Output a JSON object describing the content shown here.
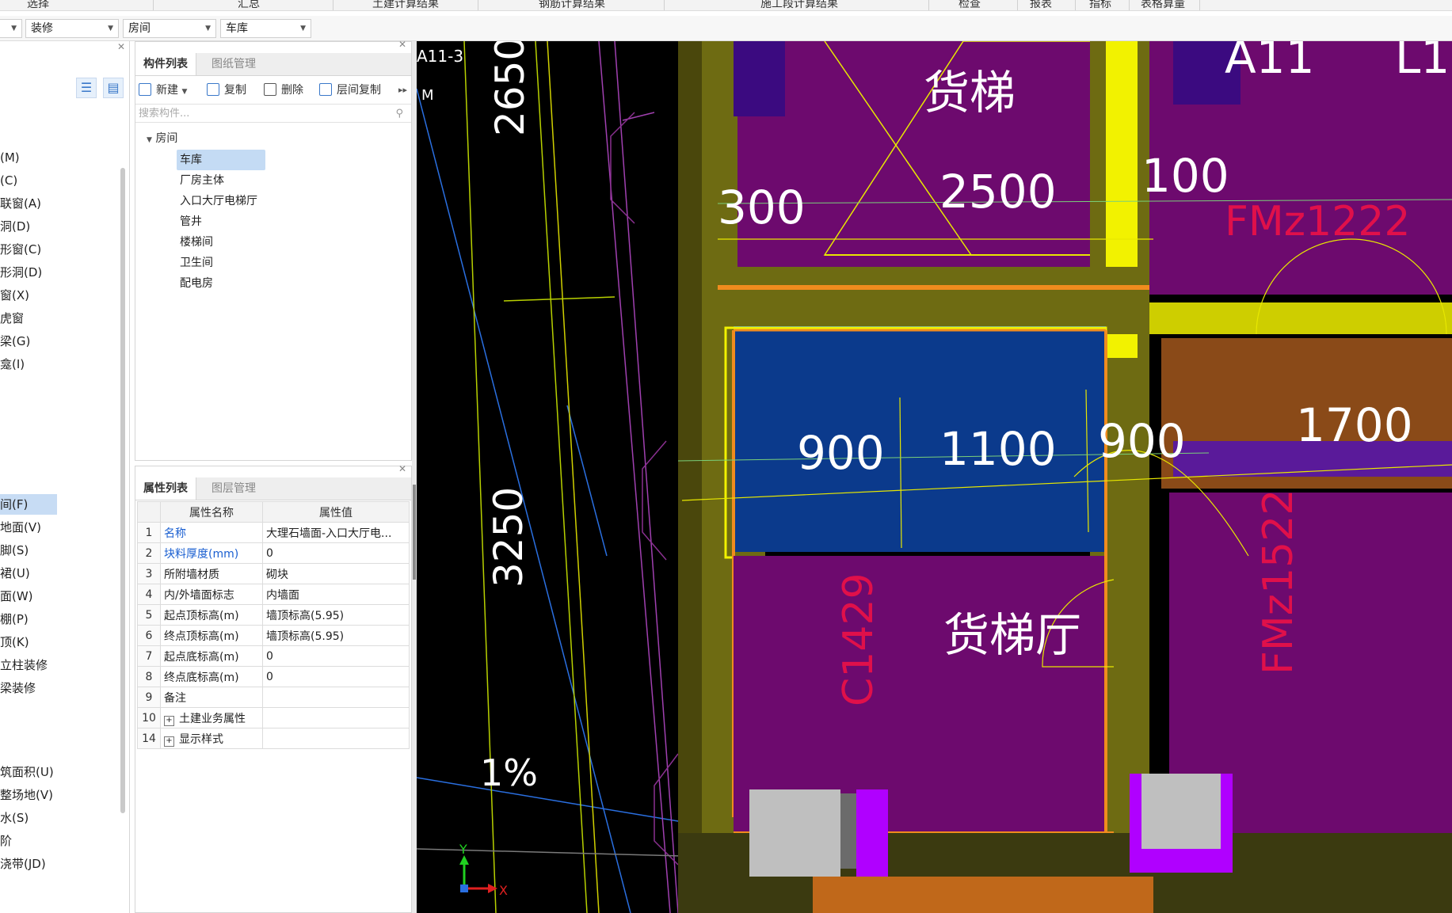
{
  "menu_tabs": [
    "选择",
    "汇总",
    "土建计算结果",
    "钢筋计算结果",
    "施工段计算结果",
    "检查",
    "报表",
    "指标",
    "表格算量"
  ],
  "selectors": [
    "",
    "装修",
    "房间",
    "车库"
  ],
  "left_panel": {
    "items_top": [
      "(M)",
      "(C)",
      "联窗(A)",
      "洞(D)",
      "形窗(C)",
      "形洞(D)",
      "窗(X)",
      "虎窗",
      "梁(G)",
      "龛(I)"
    ],
    "items_bottom": [
      "间(F)",
      "地面(V)",
      "脚(S)",
      "裙(U)",
      "面(W)",
      "棚(P)",
      "顶(K)",
      "立柱装修",
      "梁装修"
    ],
    "items_bottom2": [
      "筑面积(U)",
      "整场地(V)",
      "水(S)",
      "阶",
      "浇带(JD)"
    ]
  },
  "component_panel": {
    "tabs": [
      "构件列表",
      "图纸管理"
    ],
    "toolbar": {
      "new": "新建",
      "copy": "复制",
      "delete": "删除",
      "floor_copy": "层间复制"
    },
    "search_placeholder": "搜索构件...",
    "tree_root": "房间",
    "tree_items": [
      "车库",
      "厂房主体",
      "入口大厅电梯厅",
      "管井",
      "楼梯间",
      "卫生间",
      "配电房"
    ]
  },
  "property_panel": {
    "tabs": [
      "属性列表",
      "图层管理"
    ],
    "header_name": "属性名称",
    "header_value": "属性值",
    "rows": [
      {
        "no": "1",
        "name": "名称",
        "value": "大理石墙面-入口大厅电...",
        "blue": true
      },
      {
        "no": "2",
        "name": "块料厚度(mm)",
        "value": "0",
        "blue": true
      },
      {
        "no": "3",
        "name": "所附墙材质",
        "value": "砌块",
        "blue": false
      },
      {
        "no": "4",
        "name": "内/外墙面标志",
        "value": "内墙面",
        "blue": false
      },
      {
        "no": "5",
        "name": "起点顶标高(m)",
        "value": "墙顶标高(5.95)",
        "blue": false
      },
      {
        "no": "6",
        "name": "终点顶标高(m)",
        "value": "墙顶标高(5.95)",
        "blue": false
      },
      {
        "no": "7",
        "name": "起点底标高(m)",
        "value": "0",
        "blue": false
      },
      {
        "no": "8",
        "name": "终点底标高(m)",
        "value": "0",
        "blue": false
      },
      {
        "no": "9",
        "name": "备注",
        "value": "",
        "blue": false
      },
      {
        "no": "10",
        "name": "土建业务属性",
        "value": "",
        "blue": false,
        "expand": true
      },
      {
        "no": "14",
        "name": "显示样式",
        "value": "",
        "blue": false,
        "expand": true
      }
    ]
  },
  "canvas": {
    "axis_label": "A11-3",
    "m_label": "M",
    "dims": {
      "d2650": "2650",
      "d300": "300",
      "d2500": "2500",
      "d100": "100",
      "d900a": "900",
      "d1100": "1100",
      "d900b": "900",
      "d1700": "1700",
      "d3250": "3250",
      "slope": "1%"
    },
    "room_labels": {
      "elevator": "货梯",
      "elevator_hall": "货梯厅",
      "a11": "A11",
      "l1": "L1"
    },
    "door_labels": {
      "fm1222": "FMz1222",
      "fm1522": "FMz1522",
      "c1429": "C1429"
    },
    "axis_x": "X",
    "axis_y": "Y"
  },
  "colors": {
    "purple": "#6d0a6e",
    "olive": "#6e6b12",
    "blue_room": "#0b3a8c",
    "orange": "#f08c1e",
    "yellow": "#f2f200",
    "grey": "#bfbfbf",
    "magenta": "#b000ff"
  }
}
